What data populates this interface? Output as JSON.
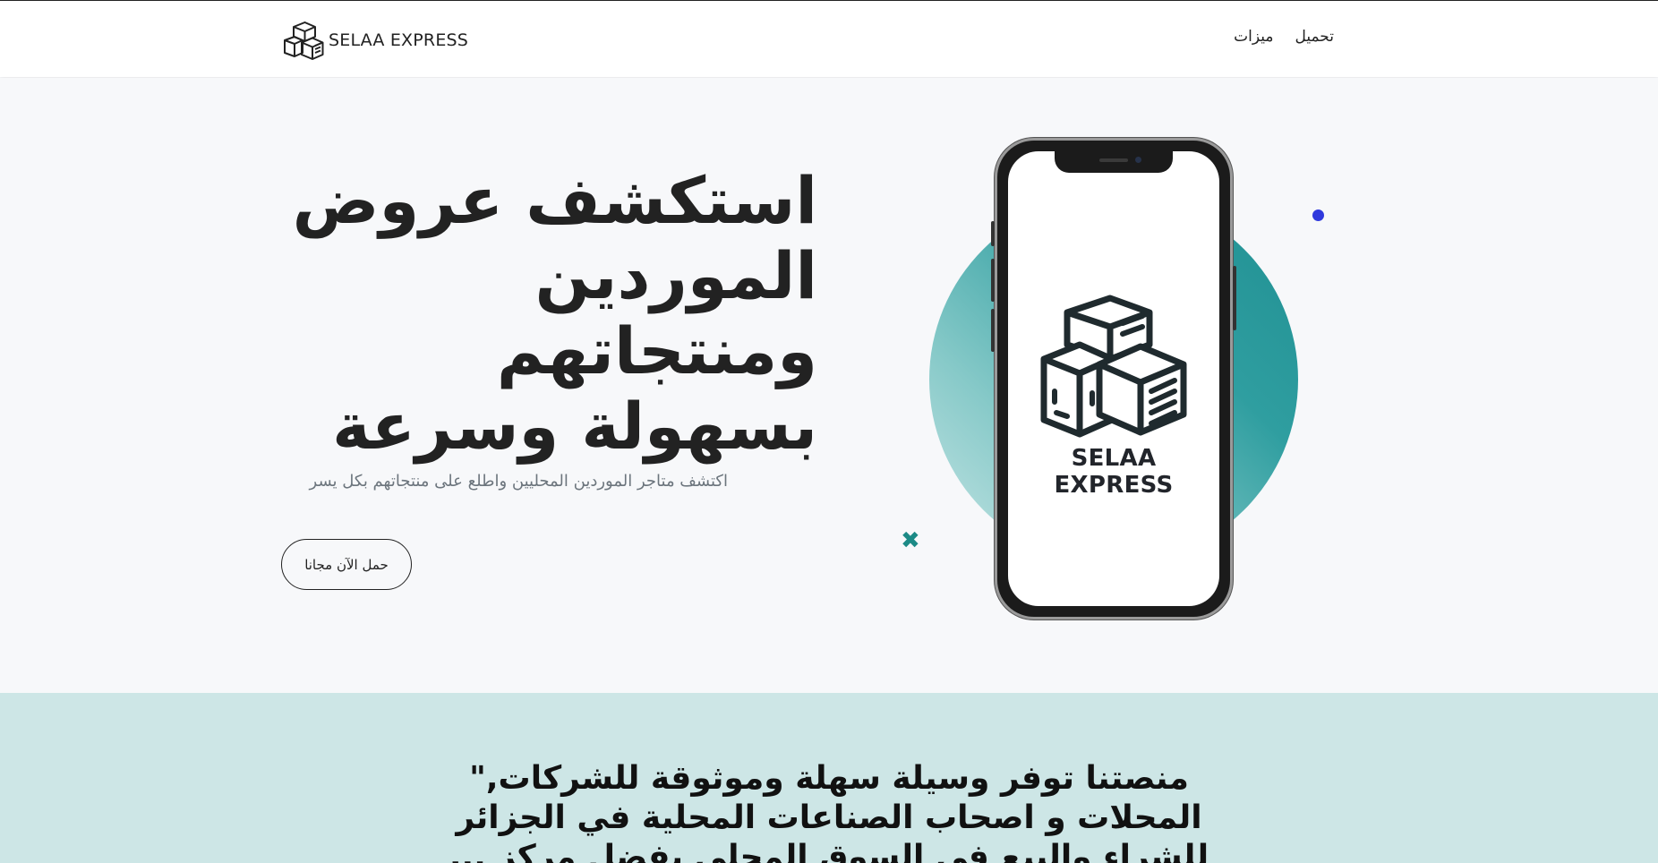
{
  "navbar": {
    "brand": "SELAA EXPRESS",
    "links": [
      "تحميل",
      "ميزات"
    ]
  },
  "hero": {
    "title": "استكشف عروض الموردين ومنتجاتهم بسهولة وسرعة",
    "subtitle": "اكتشف متاجر الموردين المحليين واطلع على منتجاتهم بكل يسر",
    "cta_label": "حمل الآن مجانا"
  },
  "phone": {
    "app_name": "SELAA EXPRESS"
  },
  "mission": {
    "text": "منصتنا توفر وسيلة سهلة وموثوقة للشركات,\" المحلات و اصحاب الصناعات المحلية في الجزائر للشراء والبيع في السوق المحلي بفضل مركز ..."
  },
  "colors": {
    "accent_teal": "#2f9ea0",
    "dot_blue": "#2f39dd",
    "mission_bg": "#cde6e6"
  },
  "icons": {
    "brand": "boxes-icon",
    "decor_cross": "x-mark-icon",
    "decor_dot": "dot-icon"
  }
}
